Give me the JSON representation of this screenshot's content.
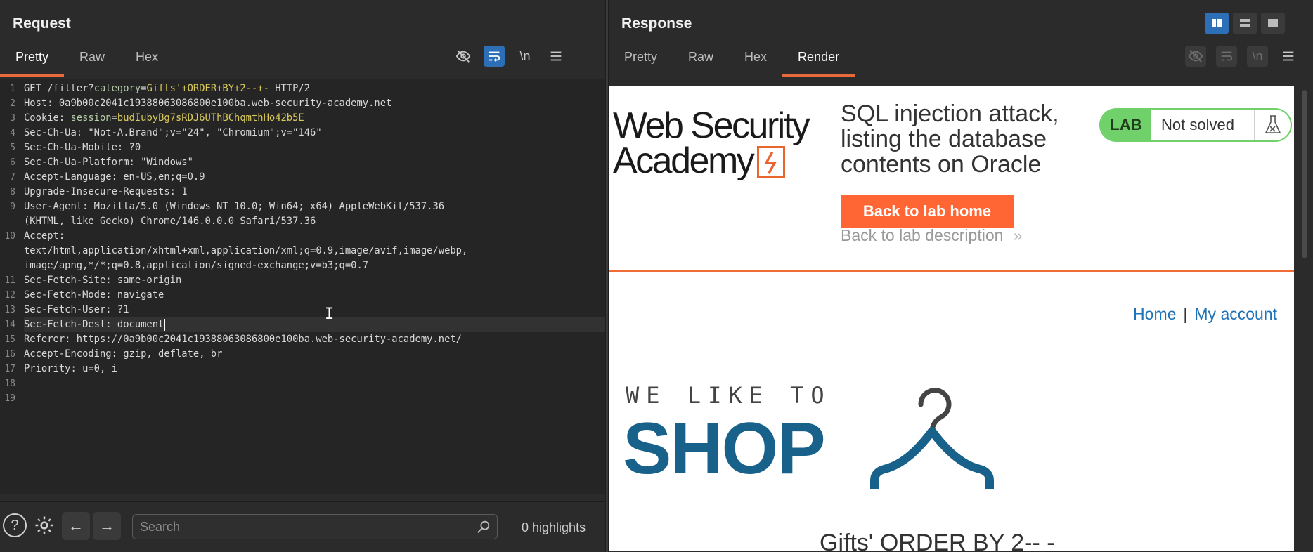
{
  "request": {
    "title": "Request",
    "tabs": [
      "Pretty",
      "Raw",
      "Hex"
    ],
    "active_tab": "Pretty",
    "toolbar_icons": [
      "hide-nonprintable-icon",
      "wrap-lines-icon",
      "newline-icon",
      "menu-icon"
    ],
    "newline_label": "\\n",
    "lines": [
      {
        "n": "1",
        "parts": [
          {
            "t": "GET /filter?",
            "c": ""
          },
          {
            "t": "category",
            "c": "g"
          },
          {
            "t": "=",
            "c": ""
          },
          {
            "t": "Gifts'+ORDER+BY+2--+-",
            "c": "y"
          },
          {
            "t": " HTTP/2",
            "c": ""
          }
        ]
      },
      {
        "n": "2",
        "parts": [
          {
            "t": "Host: 0a9b00c2041c19388063086800e100ba.web-security-academy.net",
            "c": ""
          }
        ]
      },
      {
        "n": "3",
        "parts": [
          {
            "t": "Cookie: ",
            "c": ""
          },
          {
            "t": "session",
            "c": "g"
          },
          {
            "t": "=",
            "c": ""
          },
          {
            "t": "budIubyBg7sRDJ6UThBChqmthHo42b5E",
            "c": "y"
          }
        ]
      },
      {
        "n": "4",
        "parts": [
          {
            "t": "Sec-Ch-Ua: \"Not-A.Brand\";v=\"24\", \"Chromium\";v=\"146\"",
            "c": ""
          }
        ]
      },
      {
        "n": "5",
        "parts": [
          {
            "t": "Sec-Ch-Ua-Mobile: ?0",
            "c": ""
          }
        ]
      },
      {
        "n": "6",
        "parts": [
          {
            "t": "Sec-Ch-Ua-Platform: \"Windows\"",
            "c": ""
          }
        ]
      },
      {
        "n": "7",
        "parts": [
          {
            "t": "Accept-Language: en-US,en;q=0.9",
            "c": ""
          }
        ]
      },
      {
        "n": "8",
        "parts": [
          {
            "t": "Upgrade-Insecure-Requests: 1",
            "c": ""
          }
        ]
      },
      {
        "n": "9",
        "parts": [
          {
            "t": "User-Agent: Mozilla/5.0 (Windows NT 10.0; Win64; x64) AppleWebKit/537.36",
            "c": ""
          }
        ]
      },
      {
        "n": "",
        "parts": [
          {
            "t": "(KHTML, like Gecko) Chrome/146.0.0.0 Safari/537.36",
            "c": ""
          }
        ]
      },
      {
        "n": "10",
        "parts": [
          {
            "t": "Accept:",
            "c": ""
          }
        ]
      },
      {
        "n": "",
        "parts": [
          {
            "t": "text/html,application/xhtml+xml,application/xml;q=0.9,image/avif,image/webp,",
            "c": ""
          }
        ]
      },
      {
        "n": "",
        "parts": [
          {
            "t": "image/apng,*/*;q=0.8,application/signed-exchange;v=b3;q=0.7",
            "c": ""
          }
        ]
      },
      {
        "n": "11",
        "parts": [
          {
            "t": "Sec-Fetch-Site: same-origin",
            "c": ""
          }
        ]
      },
      {
        "n": "12",
        "parts": [
          {
            "t": "Sec-Fetch-Mode: navigate",
            "c": ""
          }
        ]
      },
      {
        "n": "13",
        "parts": [
          {
            "t": "Sec-Fetch-User: ?1",
            "c": ""
          }
        ]
      },
      {
        "n": "14",
        "parts": [
          {
            "t": "Sec-Fetch-Dest: document",
            "c": ""
          }
        ],
        "current": true
      },
      {
        "n": "15",
        "parts": [
          {
            "t": "Referer: https://0a9b00c2041c19388063086800e100ba.web-security-academy.net/",
            "c": ""
          }
        ]
      },
      {
        "n": "16",
        "parts": [
          {
            "t": "Accept-Encoding: gzip, deflate, br",
            "c": ""
          }
        ]
      },
      {
        "n": "17",
        "parts": [
          {
            "t": "Priority: u=0, i",
            "c": ""
          }
        ]
      },
      {
        "n": "18",
        "parts": []
      },
      {
        "n": "19",
        "parts": []
      }
    ],
    "search_placeholder": "Search",
    "highlights": "0 highlights"
  },
  "response": {
    "title": "Response",
    "tabs": [
      "Pretty",
      "Raw",
      "Hex",
      "Render"
    ],
    "active_tab": "Render",
    "render": {
      "logo_line1": "Web Security",
      "logo_line2": "Academy",
      "lab_title": "SQL injection attack, listing the database contents on Oracle",
      "back_button": "Back to lab home",
      "back_link": "Back to lab description",
      "back_link_chevron": "»",
      "lab_badge": "LAB",
      "lab_status": "Not solved",
      "nav_home": "Home",
      "nav_sep": "|",
      "nav_account": "My account",
      "shop_tagline": "WE LIKE TO",
      "shop_word": "SHOP",
      "page_heading": "Gifts' ORDER BY 2-- -"
    }
  },
  "colors": {
    "accent_tab": "#e8693a",
    "toggle_on": "#2c6fb6",
    "lab_green": "#70d16b",
    "button_orange": "#ff6633",
    "shop_blue": "#17618a",
    "link_blue": "#1e73b8"
  }
}
